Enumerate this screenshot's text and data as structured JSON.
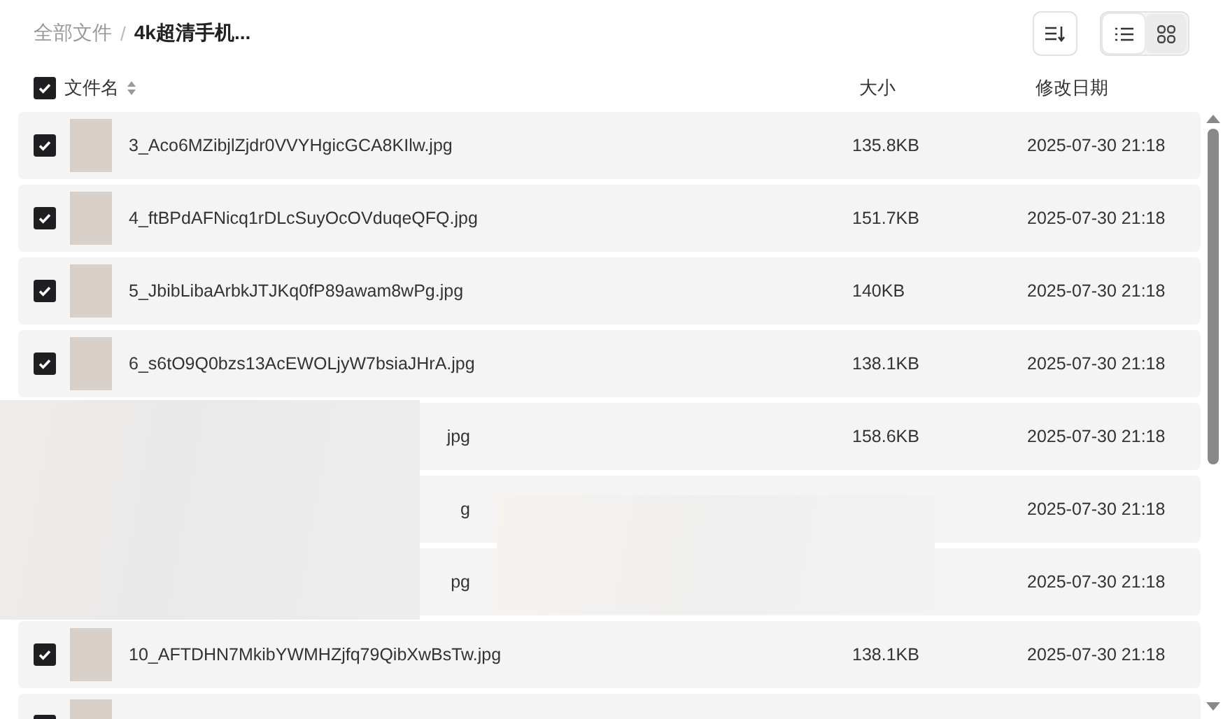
{
  "breadcrumb_separator": "/",
  "breadcrumb": [
    {
      "label": "全部文件",
      "current": false
    },
    {
      "label": "4k超清手机...",
      "current": true
    }
  ],
  "toolbar": {
    "view_modes": [
      {
        "kind": "list",
        "selected": true
      },
      {
        "kind": "grid",
        "selected": false
      }
    ]
  },
  "table": {
    "select_all": {
      "checked": true
    },
    "columns": [
      "文件名",
      "大小",
      "修改日期"
    ],
    "rows": [
      {
        "kind": "file",
        "checked": true,
        "name": "3_Aco6MZibjlZjdr0VVYHgicGCA8KIlw.jpg",
        "size": "135.8KB",
        "date": "2025-07-30 21:18"
      },
      {
        "kind": "file",
        "checked": true,
        "name": "4_ftBPdAFNicq1rDLcSuyOcOVduqeQFQ.jpg",
        "size": "151.7KB",
        "date": "2025-07-30 21:18"
      },
      {
        "kind": "file",
        "checked": true,
        "name": "5_JbibLibaArbkJTJKq0fP89awam8wPg.jpg",
        "size": "140KB",
        "date": "2025-07-30 21:18"
      },
      {
        "kind": "file",
        "checked": true,
        "name": "6_s6tO9Q0bzs13AcEWOLjyW7bsiaJHrA.jpg",
        "size": "138.1KB",
        "date": "2025-07-30 21:18"
      },
      {
        "kind": "obscured",
        "name": "jpg",
        "size": "158.6KB",
        "date": "2025-07-30 21:18"
      },
      {
        "kind": "obscured",
        "name": "g",
        "date": "2025-07-30 21:18"
      },
      {
        "kind": "obscured",
        "name": "pg",
        "date": "2025-07-30 21:18"
      },
      {
        "kind": "file",
        "checked": true,
        "name": "10_AFTDHN7MkibYWMHZjfq79QibXwBsTw.jpg",
        "size": "138.1KB",
        "date": "2025-07-30 21:18"
      },
      {
        "kind": "partial",
        "checked": true
      }
    ]
  }
}
